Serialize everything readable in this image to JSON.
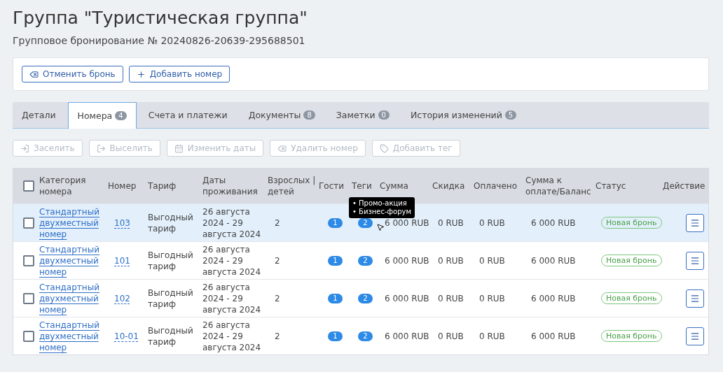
{
  "title": "Группа \"Туристическая группа\"",
  "subtitle": "Групповое бронирование № 20240826-20639-295688501",
  "actions": [
    {
      "kind": "cancel",
      "label": "Отменить бронь"
    },
    {
      "kind": "add",
      "label": "Добавить номер"
    }
  ],
  "tabs": [
    {
      "label": "Детали",
      "selected": false
    },
    {
      "label": "Номера",
      "count": "4",
      "selected": true
    },
    {
      "label": "Счета и платежи",
      "selected": false
    },
    {
      "label": "Документы",
      "count": "8",
      "selected": false
    },
    {
      "label": "Заметки",
      "count": "0",
      "selected": false
    },
    {
      "label": "История изменений",
      "count": "5",
      "selected": false
    }
  ],
  "toolbar": [
    {
      "kind": "checkin",
      "label": "Заселить",
      "disabled": true
    },
    {
      "kind": "checkout",
      "label": "Выселить",
      "disabled": true
    },
    {
      "kind": "dates",
      "label": "Изменить даты",
      "disabled": true
    },
    {
      "kind": "delete",
      "label": "Удалить номер",
      "disabled": true
    },
    {
      "kind": "tag",
      "label": "Добавить тег",
      "disabled": true
    }
  ],
  "table": {
    "select_all_checked": false,
    "columns": [
      "Категория номера",
      "Номер",
      "Тариф",
      "Даты проживания",
      "Взрослых | детей",
      "Гости",
      "Теги",
      "Сумма",
      "Скидка",
      "Оплачено",
      "Сумма к оплате/Баланс",
      "Статус",
      "Действие"
    ],
    "rows": [
      {
        "checked": false,
        "highlighted": true,
        "category": "Стандартный двухместный номер",
        "number": "103",
        "tariff": "Выгодный тариф",
        "dates": "26 августа 2024 - 29 августа 2024",
        "adults": "2",
        "guests": "1",
        "tags": "2",
        "sum": "6 000 RUB",
        "discount": "0 RUB",
        "paid": "0 RUB",
        "balance": "6 000 RUB",
        "status": "Новая бронь",
        "tooltip": [
          "• Промо-акция",
          "• Бизнес-форум"
        ]
      },
      {
        "checked": false,
        "highlighted": false,
        "category": "Стандартный двухместный номер",
        "number": "101",
        "tariff": "Выгодный тариф",
        "dates": "26 августа 2024 - 29 августа 2024",
        "adults": "2",
        "guests": "1",
        "tags": "2",
        "sum": "6 000 RUB",
        "discount": "0 RUB",
        "paid": "0 RUB",
        "balance": "6 000 RUB",
        "status": "Новая бронь"
      },
      {
        "checked": false,
        "highlighted": false,
        "category": "Стандартный двухместный номер",
        "number": "102",
        "tariff": "Выгодный тариф",
        "dates": "26 августа 2024 - 29 августа 2024",
        "adults": "2",
        "guests": "1",
        "tags": "2",
        "sum": "6 000 RUB",
        "discount": "0 RUB",
        "paid": "0 RUB",
        "balance": "6 000 RUB",
        "status": "Новая бронь"
      },
      {
        "checked": false,
        "highlighted": false,
        "category": "Стандартный двухместный номер",
        "number": "10-01",
        "tariff": "Выгодный тариф",
        "dates": "26 августа 2024 - 29 августа 2024",
        "adults": "2",
        "guests": "1",
        "tags": "2",
        "sum": "6 000 RUB",
        "discount": "0 RUB",
        "paid": "0 RUB",
        "balance": "6 000 RUB",
        "status": "Новая бронь"
      }
    ]
  }
}
